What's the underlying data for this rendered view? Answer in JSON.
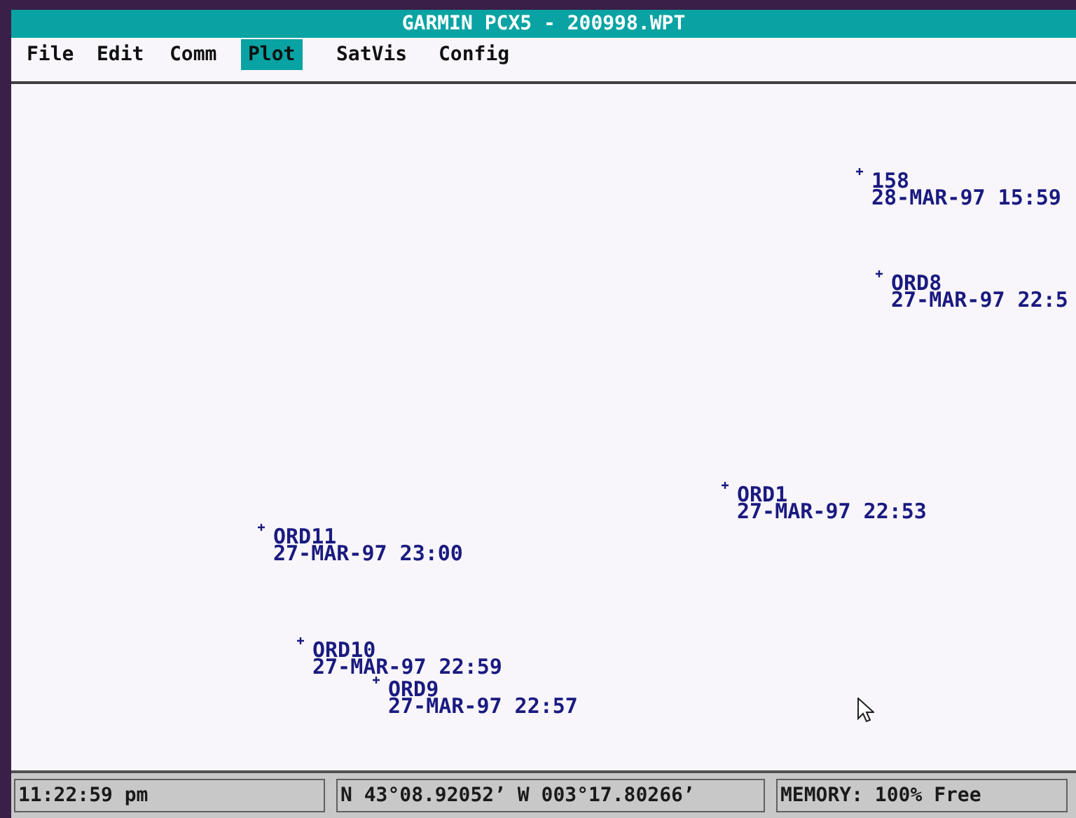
{
  "window": {
    "title": "GARMIN PCX5 - 200998.WPT"
  },
  "menu": [
    {
      "label": "File",
      "selected": false
    },
    {
      "label": "Edit",
      "selected": false
    },
    {
      "label": "Comm",
      "selected": false
    },
    {
      "label": "Plot",
      "selected": true
    },
    {
      "label": "SatVis",
      "selected": false
    },
    {
      "label": "Config",
      "selected": false
    }
  ],
  "waypoints": [
    {
      "name": "158",
      "date": "28-MAR-97 15:59"
    },
    {
      "name": "ORD8",
      "date": "27-MAR-97 22:5"
    },
    {
      "name": "ORD1",
      "date": "27-MAR-97 22:53"
    },
    {
      "name": "ORD11",
      "date": "27-MAR-97 23:00"
    },
    {
      "name": "ORD10",
      "date": "27-MAR-97 22:59"
    },
    {
      "name": "ORD9",
      "date": "27-MAR-97 22:57"
    }
  ],
  "status_bar": {
    "time": "11:22:59 pm",
    "position": "N 43°08.92052’ W 003°17.80266’",
    "memory": "MEMORY: 100% Free"
  }
}
